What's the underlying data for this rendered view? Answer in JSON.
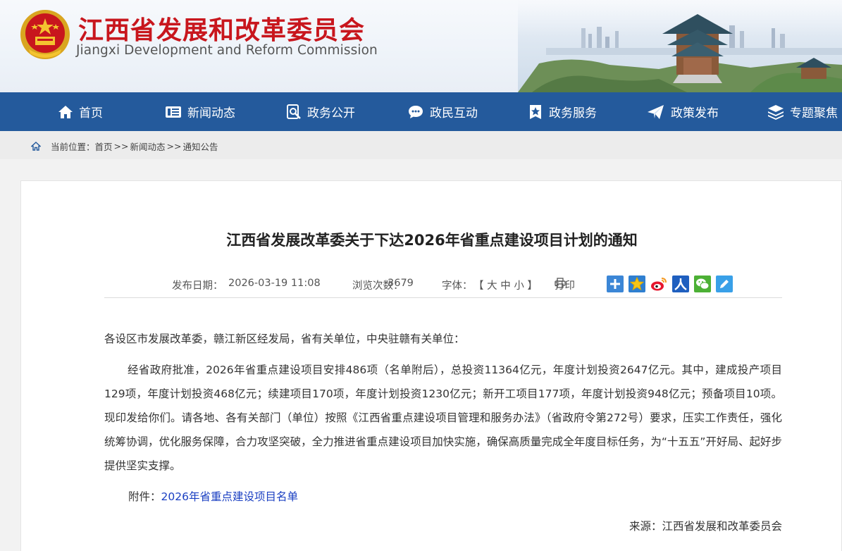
{
  "header": {
    "title_cn": "江西省发展和改革委员会",
    "title_en": "Jiangxi Development and Reform Commission"
  },
  "nav": [
    {
      "label": "首页",
      "icon": "home-icon"
    },
    {
      "label": "新闻动态",
      "icon": "news-icon"
    },
    {
      "label": "政务公开",
      "icon": "search-doc-icon"
    },
    {
      "label": "政民互动",
      "icon": "chat-icon"
    },
    {
      "label": "政务服务",
      "icon": "star-badge-icon"
    },
    {
      "label": "政策发布",
      "icon": "paper-plane-icon"
    },
    {
      "label": "专题聚焦",
      "icon": "layers-icon"
    }
  ],
  "breadcrumb": {
    "prefix": "当前位置：",
    "items": [
      "首页",
      "新闻动态",
      "通知公告"
    ],
    "separator": ">>"
  },
  "article": {
    "title": "江西省发展改革委关于下达2026年省重点建设项目计划的通知",
    "date_label": "发布日期：",
    "date_value": "2026-03-19 11:08",
    "views_label": "浏览次数：",
    "views_value": "3679",
    "font_label": "字体：",
    "font_sizes": "【 大 中 小 】",
    "print_label": "打印",
    "salutation": "各设区市发展改革委，赣江新区经发局，省有关单位，中央驻赣有关单位：",
    "body": "经省政府批准，2026年省重点建设项目安排486项（名单附后），总投资11364亿元，年度计划投资2647亿元。其中，建成投产项目129项，年度计划投资468亿元；续建项目170项，年度计划投资1230亿元；新开工项目177项，年度计划投资948亿元；预备项目10项。现印发给你们。请各地、各有关部门（单位）按照《江西省重点建设项目管理和服务办法》（省政府令第272号）要求，压实工作责任，强化统筹协调，优化服务保障，合力攻坚突破，全力推进省重点建设项目加快实施，确保高质量完成全年度目标任务，为“十五五”开好局、起好步提供坚实支撑。",
    "attachment_label": "附件：",
    "attachment_link": "2026年省重点建设项目名单",
    "source": "来源：江西省发展和改革委员会"
  },
  "share_icons": [
    "plus-share-icon",
    "favorite-star-icon",
    "weibo-icon",
    "renmin-icon",
    "wechat-icon",
    "edit-note-icon"
  ],
  "colors": {
    "brand_red": "#c8161d",
    "nav_blue": "#245a9c",
    "link_blue": "#1a3fc2"
  }
}
